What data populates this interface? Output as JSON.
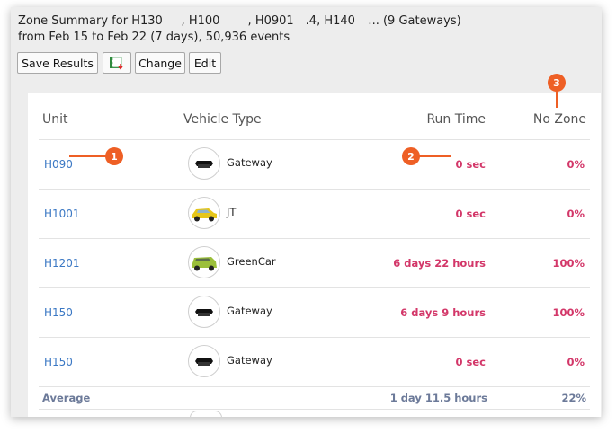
{
  "summary": {
    "line1": "Zone Summary for H130        , H100            , H0901     .4, H140     ... (9 Gateways)",
    "line2": "from Feb 15 to Feb 22 (7 days), 50,936 events"
  },
  "toolbar": {
    "save_label": "Save Results",
    "export_icon": "excel-export-icon",
    "change_label": "Change",
    "edit_label": "Edit"
  },
  "table": {
    "headers": {
      "unit": "Unit",
      "vehicle_type": "Vehicle Type",
      "run_time": "Run Time",
      "no_zone": "No Zone"
    },
    "rows": [
      {
        "unit": "H090",
        "vehicle": "Gateway",
        "icon": "gateway-device-icon",
        "run_time": "0 sec",
        "no_zone": "0%"
      },
      {
        "unit": "H1001",
        "vehicle": "JT",
        "icon": "yellow-car-icon",
        "run_time": "0 sec",
        "no_zone": "0%"
      },
      {
        "unit": "H1201",
        "vehicle": "GreenCar",
        "icon": "green-car-icon",
        "run_time": "6 days 22 hours",
        "no_zone": "100%"
      },
      {
        "unit": "H150",
        "vehicle": "Gateway",
        "icon": "gateway-device-icon",
        "run_time": "6 days 9 hours",
        "no_zone": "100%"
      },
      {
        "unit": "H150",
        "vehicle": "Gateway",
        "icon": "gateway-device-icon",
        "run_time": "0 sec",
        "no_zone": "0%"
      }
    ],
    "average": {
      "label": "Average",
      "run_time": "1 day 11.5 hours",
      "no_zone": "22%"
    }
  },
  "callouts": [
    "1",
    "2",
    "3"
  ],
  "colors": {
    "link": "#3b78c4",
    "value": "#d33769",
    "average": "#6c7a99",
    "callout": "#ee5f25"
  }
}
